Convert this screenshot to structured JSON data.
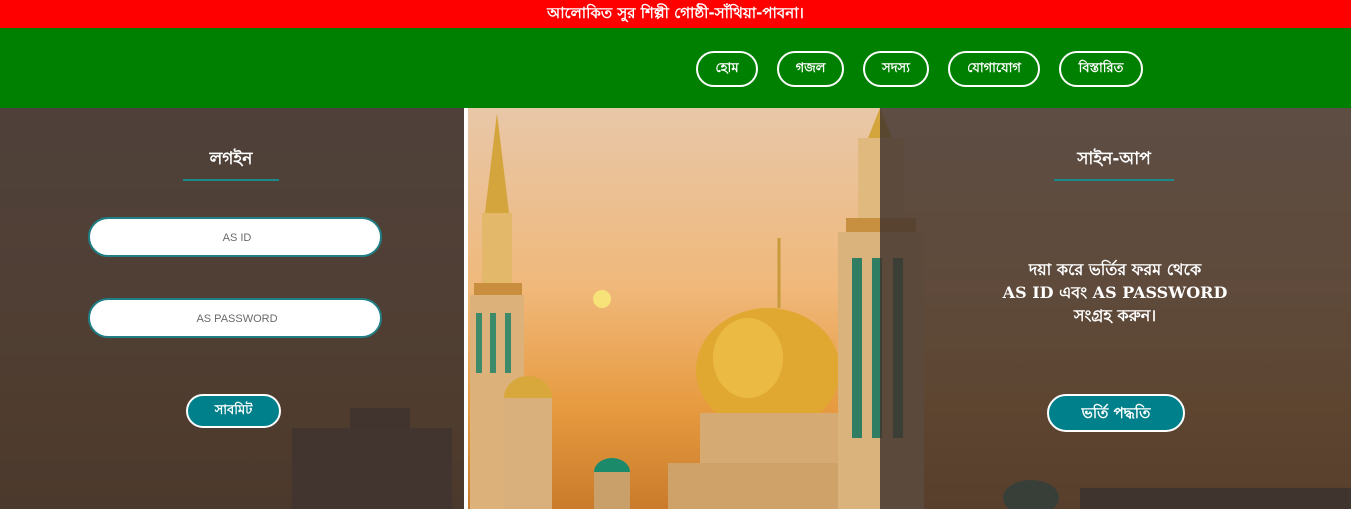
{
  "topbar": {
    "title": "আলোকিত সুর শিল্পী গোষ্ঠী-সাঁথিয়া-পাবনা।"
  },
  "nav": {
    "items": [
      "হোম",
      "গজল",
      "সদস্য",
      "যোগাযোগ",
      "বিস্তারিত"
    ]
  },
  "login": {
    "title": "লগইন",
    "id_placeholder": "AS ID",
    "password_placeholder": "AS PASSWORD",
    "submit_label": "সাবমিট"
  },
  "signup": {
    "title": "সাইন-আপ",
    "message_line1": "দয়া করে ভর্তির ফরম থেকে",
    "message_line2": "AS ID এবং AS PASSWORD",
    "message_line3": "সংগ্রহ করুন।",
    "button_label": "ভর্তি পদ্ধতি"
  },
  "colors": {
    "topbar": "#ff0000",
    "navbar": "#008000",
    "accent": "#00808a"
  }
}
